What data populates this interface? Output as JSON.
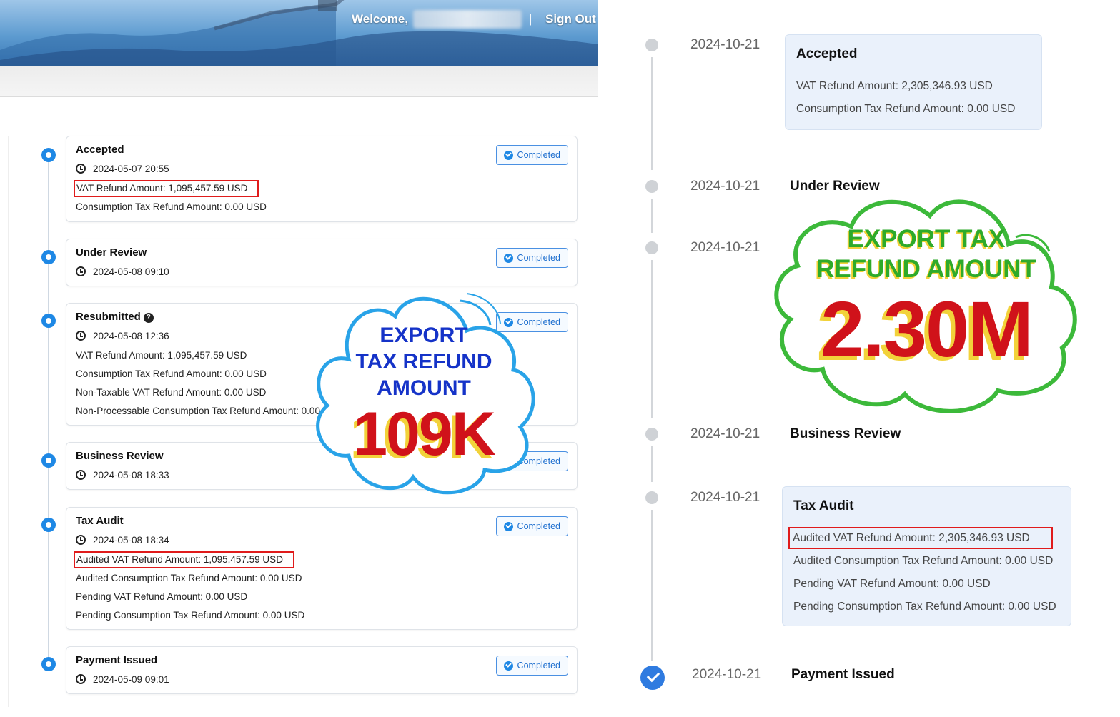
{
  "header": {
    "welcome_label": "Welcome,",
    "separator": "|",
    "sign_out_label": "Sign Out"
  },
  "left_timeline": {
    "status_label": "Completed",
    "steps": [
      {
        "title": "Accepted",
        "time": "2024-05-07 20:55",
        "rows": [
          "VAT Refund Amount:  1,095,457.59 USD",
          "Consumption Tax Refund Amount:  0.00 USD"
        ]
      },
      {
        "title": "Under Review",
        "time": "2024-05-08 09:10",
        "rows": []
      },
      {
        "title": "Resubmitted",
        "time": "2024-05-08 12:36",
        "rows": [
          "VAT Refund Amount:  1,095,457.59 USD",
          "Consumption Tax Refund Amount:  0.00 USD",
          "Non-Taxable VAT Refund Amount:  0.00 USD",
          "Non-Processable Consumption Tax Refund Amount:  0.00 USD"
        ]
      },
      {
        "title": "Business Review",
        "time": "2024-05-08 18:33",
        "rows": []
      },
      {
        "title": "Tax Audit",
        "time": "2024-05-08 18:34",
        "rows": [
          "Audited VAT Refund Amount:  1,095,457.59 USD",
          "Audited Consumption Tax Refund Amount:  0.00 USD",
          "Pending VAT Refund Amount:  0.00 USD",
          "Pending Consumption Tax Refund Amount:  0.00 USD"
        ]
      },
      {
        "title": "Payment Issued",
        "time": "2024-05-09 09:01",
        "rows": []
      }
    ]
  },
  "right_timeline": {
    "steps": [
      {
        "date": "2024-10-21",
        "title": "Accepted",
        "rows": [
          "VAT Refund Amount:  2,305,346.93 USD",
          "Consumption Tax Refund Amount:  0.00 USD"
        ]
      },
      {
        "date": "2024-10-21",
        "title": "Under Review",
        "rows": []
      },
      {
        "date": "2024-10-21",
        "title": "",
        "rows": []
      },
      {
        "date": "2024-10-21",
        "title": "Business Review",
        "rows": []
      },
      {
        "date": "2024-10-21",
        "title": "Tax Audit",
        "rows": [
          "Audited VAT Refund Amount:  2,305,346.93 USD",
          "Audited Consumption Tax Refund Amount:  0.00 USD",
          "Pending VAT Refund Amount:  0.00 USD",
          "Pending Consumption Tax Refund Amount:  0.00 USD"
        ]
      },
      {
        "date": "2024-10-21",
        "title": "Payment Issued",
        "rows": []
      }
    ]
  },
  "sticker_left": {
    "line1": "EXPORT",
    "line2": "TAX REFUND",
    "line3": "AMOUNT",
    "amount": "109K"
  },
  "sticker_right": {
    "line1": "EXPORT TAX",
    "line2": "REFUND AMOUNT",
    "amount": "2.30M"
  },
  "colors": {
    "accent_blue": "#1e88e5",
    "highlight_red": "#e01b1b",
    "sticker_blue_outline": "#29a3e8",
    "sticker_green_outline": "#3cb93a",
    "amount_red": "#d0121a",
    "amount_shadow_yellow": "#f2d23a",
    "text_blue": "#1533c8",
    "text_green": "#2eaa2a"
  }
}
